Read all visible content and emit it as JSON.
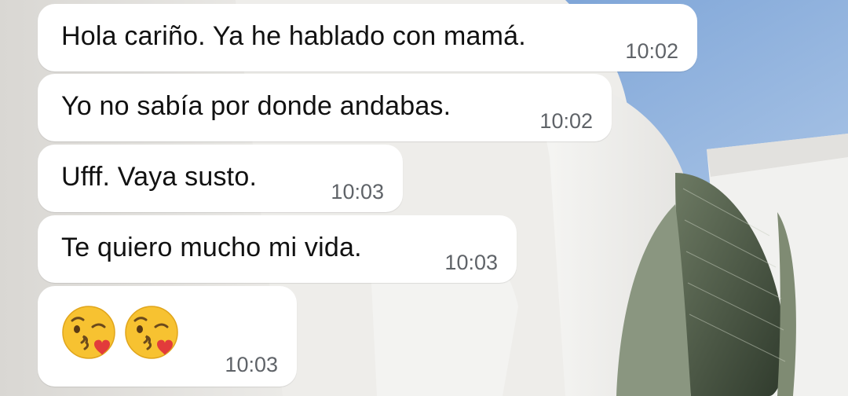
{
  "messages": [
    {
      "text": "Hola cariño. Ya he hablado con mamá.",
      "time": "10:02"
    },
    {
      "text": "Yo no sabía por donde andabas.",
      "time": "10:02"
    },
    {
      "text": "Ufff. Vaya susto.",
      "time": "10:03"
    },
    {
      "text": "Te quiero mucho mi vida.",
      "time": "10:03"
    },
    {
      "emoji": [
        "kissing-face-emoji",
        "kissing-face-emoji"
      ],
      "time": "10:03"
    }
  ],
  "colors": {
    "bubble": "#ffffff",
    "text": "#111111",
    "timestamp": "#5f6368",
    "sky": "#8fb2de"
  }
}
